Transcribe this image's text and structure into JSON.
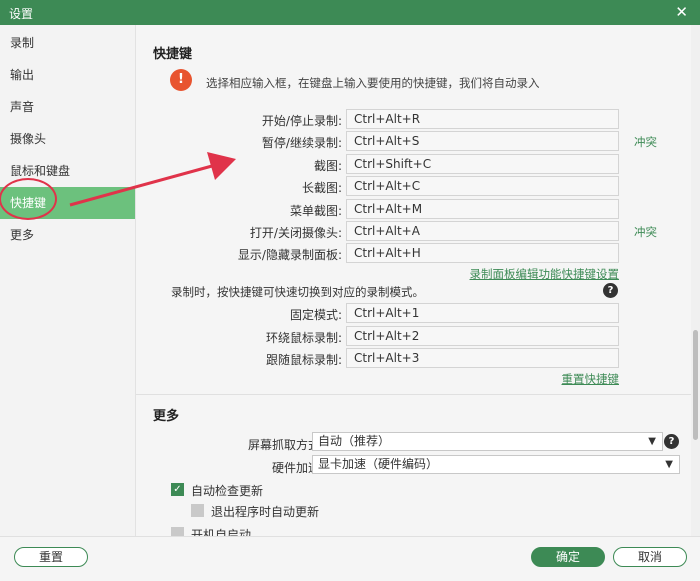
{
  "window": {
    "title": "设置",
    "close_icon": "close-icon"
  },
  "sidebar": {
    "items": [
      {
        "label": "录制"
      },
      {
        "label": "输出"
      },
      {
        "label": "声音"
      },
      {
        "label": "摄像头"
      },
      {
        "label": "鼠标和键盘"
      },
      {
        "label": "快捷键"
      },
      {
        "label": "更多"
      }
    ],
    "active": "快捷键"
  },
  "hotkeys": {
    "section_title": "快捷键",
    "note": "选择相应输入框，在键盘上输入要使用的快捷键，我们将自动录入",
    "rows": [
      {
        "label": "开始/停止录制:",
        "key": "Ctrl+Alt+R"
      },
      {
        "label": "暂停/继续录制:",
        "key": "Ctrl+Alt+S",
        "status": "冲突"
      },
      {
        "label": "截图:",
        "key": "Ctrl+Shift+C"
      },
      {
        "label": "长截图:",
        "key": "Ctrl+Alt+C"
      },
      {
        "label": "菜单截图:",
        "key": "Ctrl+Alt+M"
      },
      {
        "label": "打开/关闭摄像头:",
        "key": "Ctrl+Alt+A",
        "status": "冲突"
      },
      {
        "label": "显示/隐藏录制面板:",
        "key": "Ctrl+Alt+H"
      }
    ],
    "panel_link": "录制面板编辑功能快捷键设置",
    "mode_note": "录制时，按快捷键可快速切换到对应的录制模式。",
    "mode_rows": [
      {
        "label": "固定模式:",
        "key": "Ctrl+Alt+1"
      },
      {
        "label": "环绕鼠标录制:",
        "key": "Ctrl+Alt+2"
      },
      {
        "label": "跟随鼠标录制:",
        "key": "Ctrl+Alt+3"
      }
    ],
    "reset_link": "重置快捷键"
  },
  "more": {
    "section_title": "更多",
    "capture_label": "屏幕抓取方式:",
    "capture_value": "自动（推荐）",
    "hw_label": "硬件加速:",
    "hw_value": "显卡加速（硬件编码）",
    "auto_update_label": "自动检查更新",
    "auto_update_checked": true,
    "exit_update_label": "退出程序时自动更新",
    "exit_update_checked": false,
    "startup_label": "开机自启动",
    "startup_checked": false
  },
  "footer": {
    "reset": "重置",
    "ok": "确定",
    "cancel": "取消"
  },
  "colors": {
    "brand": "#3d8a55",
    "active_nav": "#6cc17d",
    "annotation": "#e0334a",
    "warning": "#e8542f"
  }
}
